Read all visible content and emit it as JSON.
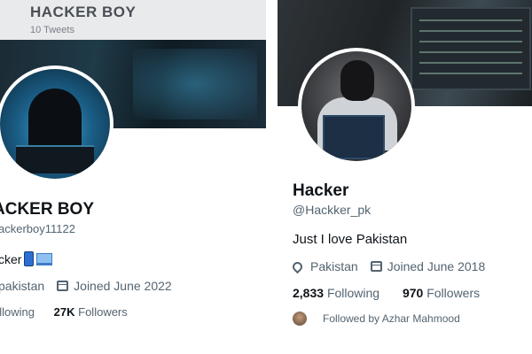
{
  "left_profile": {
    "header_name": "HACKER BOY",
    "tweet_count": "10 Tweets",
    "name": "ACKER BOY",
    "handle": "ackerboy11122",
    "bio": "cker",
    "location": "pakistan",
    "joined": "Joined June 2022",
    "following_label": "ollowing",
    "followers_count": "27K",
    "followers_label": "Followers"
  },
  "right_profile": {
    "name": "Hacker",
    "handle": "@Hackker_pk",
    "bio": "Just I love Pakistan",
    "location": "Pakistan",
    "joined": "Joined June 2018",
    "following_count": "2,833",
    "following_label": "Following",
    "followers_count": "970",
    "followers_label": "Followers",
    "followed_by": "Followed by Azhar Mahmood"
  },
  "icons": {
    "left_bio_emoji_1": "mobile-phone-icon",
    "left_bio_emoji_2": "laptop-icon",
    "calendar": "calendar-icon",
    "location": "location-pin-icon"
  }
}
